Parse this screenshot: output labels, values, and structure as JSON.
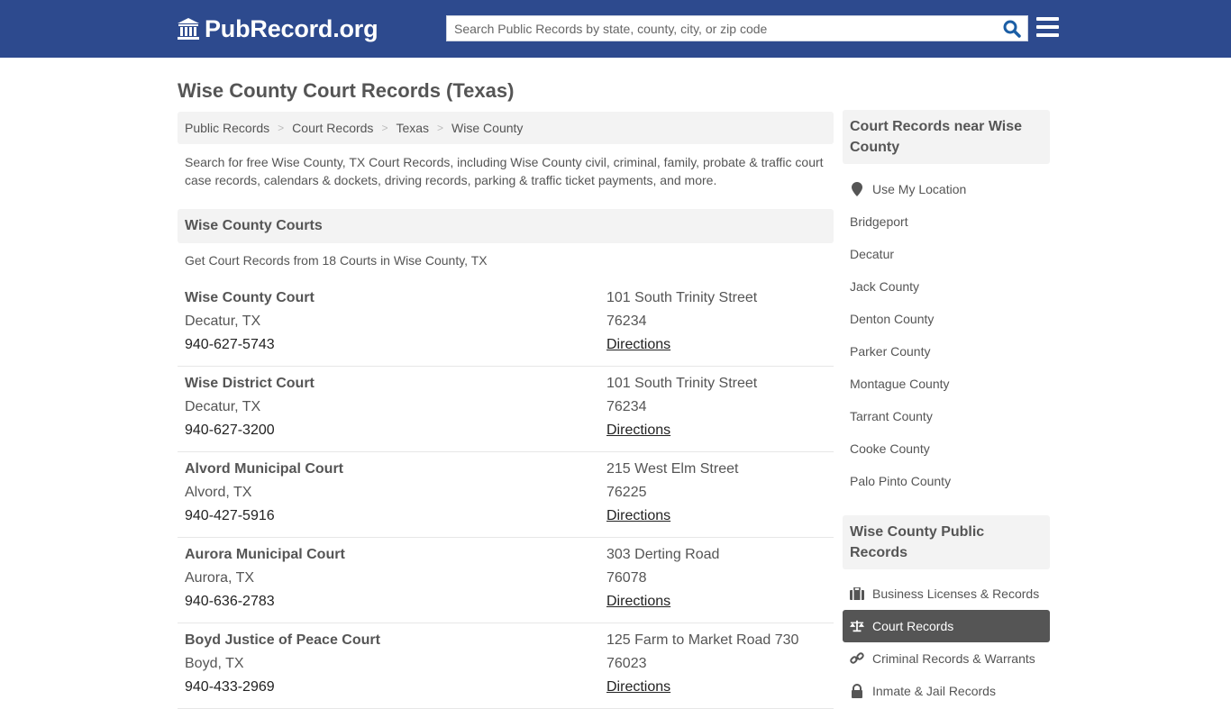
{
  "header": {
    "logo_text": "PubRecord.org",
    "search_placeholder": "Search Public Records by state, county, city, or zip code",
    "search_value": "",
    "brand_color": "#2d4a8e"
  },
  "page": {
    "title": "Wise County Court Records (Texas)",
    "breadcrumb": [
      "Public Records",
      "Court Records",
      "Texas",
      "Wise County"
    ],
    "intro": "Search for free Wise County, TX Court Records, including Wise County civil, criminal, family, probate & traffic court case records, calendars & dockets, driving records, parking & traffic ticket payments, and more.",
    "section_title": "Wise County Courts",
    "section_subtext": "Get Court Records from 18 Courts in Wise County, TX"
  },
  "courts": [
    {
      "name": "Wise County Court",
      "city": "Decatur, TX",
      "phone": "940-627-5743",
      "address": "101 South Trinity Street",
      "zip": "76234",
      "directions": "Directions"
    },
    {
      "name": "Wise District Court",
      "city": "Decatur, TX",
      "phone": "940-627-3200",
      "address": "101 South Trinity Street",
      "zip": "76234",
      "directions": "Directions"
    },
    {
      "name": "Alvord Municipal Court",
      "city": "Alvord, TX",
      "phone": "940-427-5916",
      "address": "215 West Elm Street",
      "zip": "76225",
      "directions": "Directions"
    },
    {
      "name": "Aurora Municipal Court",
      "city": "Aurora, TX",
      "phone": "940-636-2783",
      "address": "303 Derting Road",
      "zip": "76078",
      "directions": "Directions"
    },
    {
      "name": "Boyd Justice of Peace Court",
      "city": "Boyd, TX",
      "phone": "940-433-2969",
      "address": "125 Farm to Market Road 730",
      "zip": "76023",
      "directions": "Directions"
    }
  ],
  "sidebar": {
    "nearby_title": "Court Records near Wise County",
    "use_location": "Use My Location",
    "nearby": [
      "Bridgeport",
      "Decatur",
      "Jack County",
      "Denton County",
      "Parker County",
      "Montague County",
      "Tarrant County",
      "Cooke County",
      "Palo Pinto County"
    ],
    "records_title": "Wise County Public Records",
    "records": [
      {
        "label": "Business Licenses & Records",
        "icon": "briefcase-icon",
        "active": false
      },
      {
        "label": "Court Records",
        "icon": "scales-icon",
        "active": true
      },
      {
        "label": "Criminal Records & Warrants",
        "icon": "link-icon",
        "active": false
      },
      {
        "label": "Inmate & Jail Records",
        "icon": "lock-icon",
        "active": false
      }
    ]
  }
}
